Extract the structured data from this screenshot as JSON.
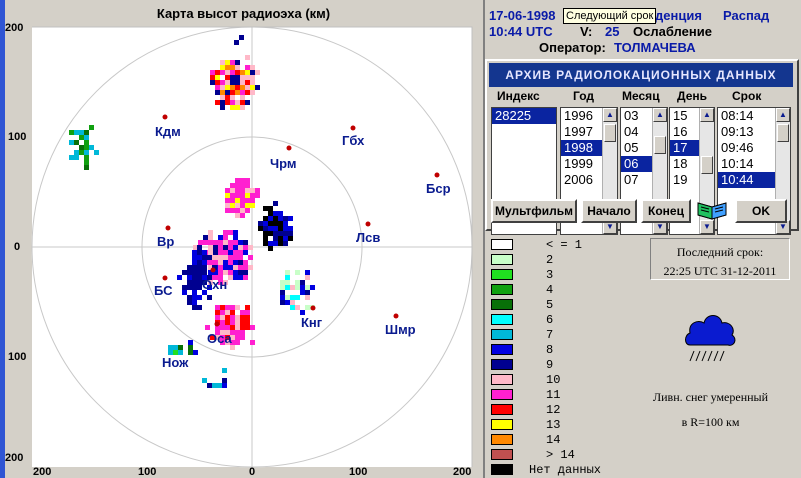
{
  "map": {
    "title": "Карта высот радиоэха (км)",
    "y_ticks": [
      "200",
      "100",
      "0",
      "100",
      "200"
    ],
    "x_ticks": [
      "200",
      "100",
      "0",
      "100",
      "200"
    ],
    "cities": [
      "Кдм",
      "Гбх",
      "Чрм",
      "Бср",
      "Лсв",
      "Вр",
      "Охн",
      "БС",
      "Кнг",
      "Шмр",
      "Оса",
      "Нож"
    ]
  },
  "header": {
    "date": "17-06-1998",
    "phenomenon": "денция",
    "decay": "Распад",
    "time": "10:44 UTC",
    "v_label": "V:",
    "v_value": "25",
    "attenuation": "Ослабление",
    "operator_label": "Оператор:",
    "operator_name": "ТОЛМАЧЕВА"
  },
  "tooltip": "Следующий срок",
  "archive": {
    "title": "АРХИВ  РАДИОЛОКАЦИОННЫХ  ДАННЫХ",
    "columns": [
      "Индекс",
      "Год",
      "Месяц",
      "День",
      "Срок"
    ],
    "index_items": [
      "28225"
    ],
    "year_items": [
      "1996",
      "1997",
      "1998",
      "1999",
      "2006"
    ],
    "month_items": [
      "03",
      "04",
      "05",
      "06",
      "07"
    ],
    "day_items": [
      "15",
      "16",
      "17",
      "18",
      "19"
    ],
    "time_items": [
      "08:14",
      "09:13",
      "09:46",
      "10:14",
      "10:44"
    ],
    "buttons": {
      "film": "Мультфильм",
      "start": "Начало",
      "end": "Конец",
      "ok": "OK"
    }
  },
  "legend": [
    {
      "label": "< = 1",
      "color": "#ffffff"
    },
    {
      "label": "2",
      "color": "#c8ffc8"
    },
    {
      "label": "3",
      "color": "#20e020"
    },
    {
      "label": "4",
      "color": "#10a010"
    },
    {
      "label": "5",
      "color": "#087008"
    },
    {
      "label": "6",
      "color": "#00ffff"
    },
    {
      "label": "7",
      "color": "#00b8d8"
    },
    {
      "label": "8",
      "color": "#0000e0"
    },
    {
      "label": "9",
      "color": "#000090"
    },
    {
      "label": "10",
      "color": "#ffb8c8"
    },
    {
      "label": "11",
      "color": "#ff20d0"
    },
    {
      "label": "12",
      "color": "#ff0000"
    },
    {
      "label": "13",
      "color": "#ffff00"
    },
    {
      "label": "14",
      "color": "#ff8800"
    },
    {
      "label": "> 14",
      "color": "#c05050"
    },
    {
      "label": "Нет данных",
      "color": "#000000"
    }
  ],
  "last_term": {
    "label": "Последний срок:",
    "value": "22:25 UTC 31-12-2011"
  },
  "weather": {
    "line1": "Ливн. снег умеренный",
    "line2": "в R=100 км"
  }
}
